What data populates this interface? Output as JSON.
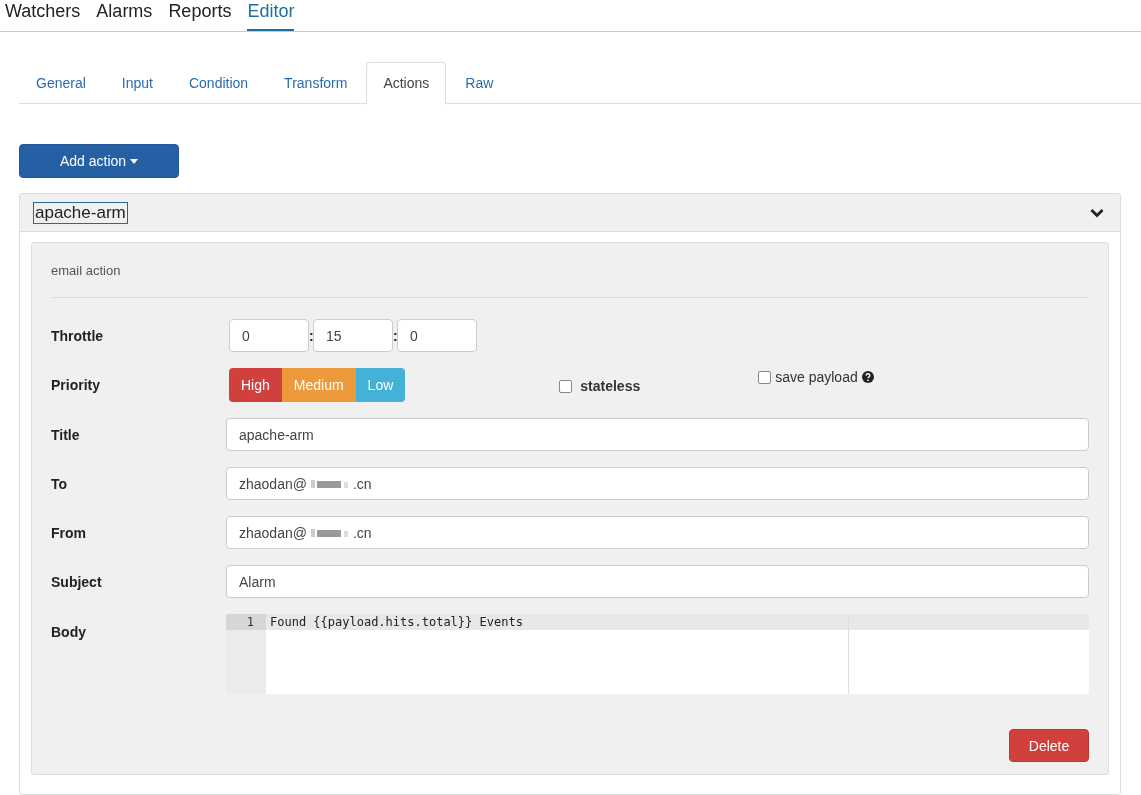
{
  "nav": [
    {
      "label": "Watchers",
      "selected": false
    },
    {
      "label": "Alarms",
      "selected": false
    },
    {
      "label": "Reports",
      "selected": false
    },
    {
      "label": "Editor",
      "selected": true
    }
  ],
  "tabs": [
    {
      "label": "General",
      "selected": false
    },
    {
      "label": "Input",
      "selected": false
    },
    {
      "label": "Condition",
      "selected": false
    },
    {
      "label": "Transform",
      "selected": false
    },
    {
      "label": "Actions",
      "selected": true
    },
    {
      "label": "Raw",
      "selected": false
    }
  ],
  "add_button": "Add action",
  "action": {
    "name": "apache-arm",
    "expanded": true,
    "type_label": "email action",
    "rows": [
      {
        "kind": "throttle",
        "label": "Throttle",
        "parts": [
          "0",
          "15",
          "0"
        ],
        "separator": ":"
      },
      {
        "kind": "priority",
        "label": "Priority",
        "options": [
          {
            "label": "High",
            "color": "#d0403d"
          },
          {
            "label": "Medium",
            "color": "#ec9a3c"
          },
          {
            "label": "Low",
            "color": "#43b1d8"
          }
        ],
        "checkboxes": [
          {
            "label": "stateless",
            "checked": false,
            "help": false
          },
          {
            "label": "save payload",
            "checked": false,
            "help": true
          }
        ]
      },
      {
        "kind": "text",
        "label": "Title",
        "value": "apache-arm"
      },
      {
        "kind": "redacted",
        "label": "To",
        "value_start": "zhaodan@",
        "value_end": ".cn"
      },
      {
        "kind": "redacted",
        "label": "From",
        "value_start": "zhaodan@",
        "value_end": ".cn"
      },
      {
        "kind": "text",
        "label": "Subject",
        "value": "Alarm"
      },
      {
        "kind": "code",
        "label": "Body",
        "lines": [
          {
            "number": "1",
            "text": "Found {{payload.hits.total}} Events"
          }
        ]
      }
    ],
    "delete_button": "Delete"
  }
}
